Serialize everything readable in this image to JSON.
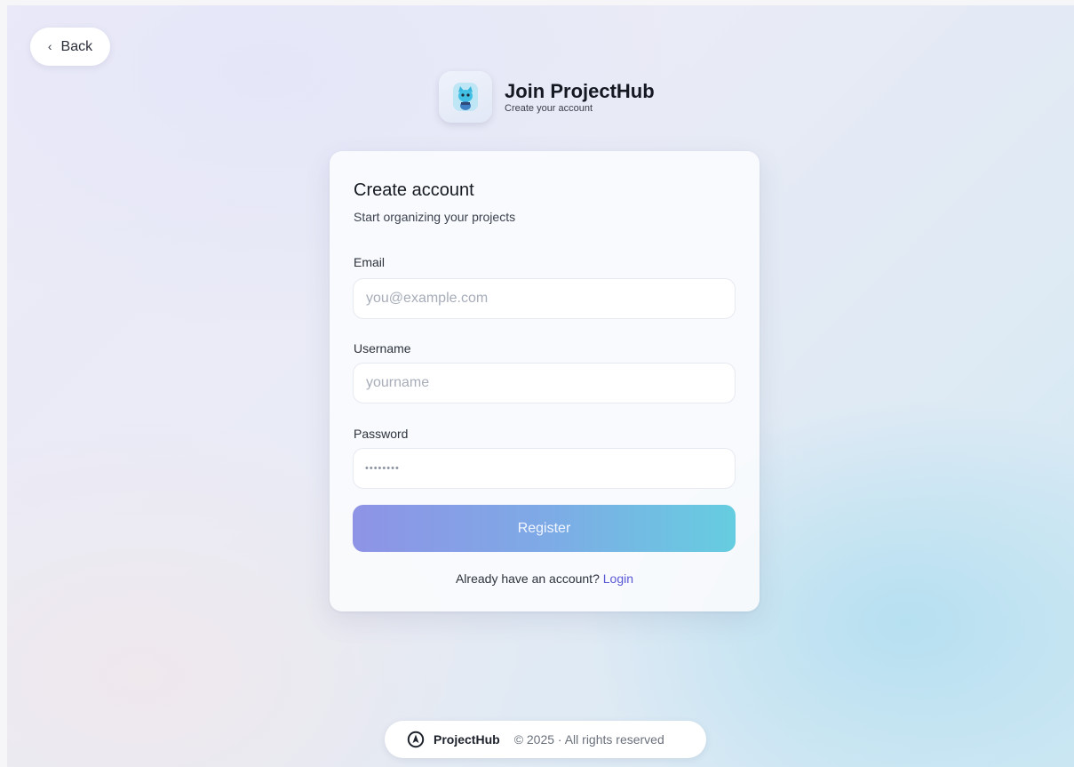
{
  "nav": {
    "back_label": "Back",
    "back_icon": "chevron-left-icon"
  },
  "brand": {
    "title": "Join ProjectHub",
    "subtitle": "Create your account",
    "logo_icon": "cat-mascot-icon"
  },
  "form": {
    "title": "Create account",
    "subtitle": "Start organizing your projects",
    "email": {
      "label": "Email",
      "placeholder": "you@example.com",
      "value": ""
    },
    "username": {
      "label": "Username",
      "placeholder": "yourname",
      "value": ""
    },
    "password": {
      "label": "Password",
      "masked_value": "••••••••"
    },
    "submit_label": "Register",
    "login_prompt": "Already have an account?",
    "login_link": "Login"
  },
  "footer": {
    "icon": "compass-icon",
    "brand": "ProjectHub",
    "copyright": "© 2025 · All rights reserved"
  },
  "colors": {
    "accent_start": "#8e93e6",
    "accent_end": "#66cde0",
    "link": "#5b58d6"
  }
}
